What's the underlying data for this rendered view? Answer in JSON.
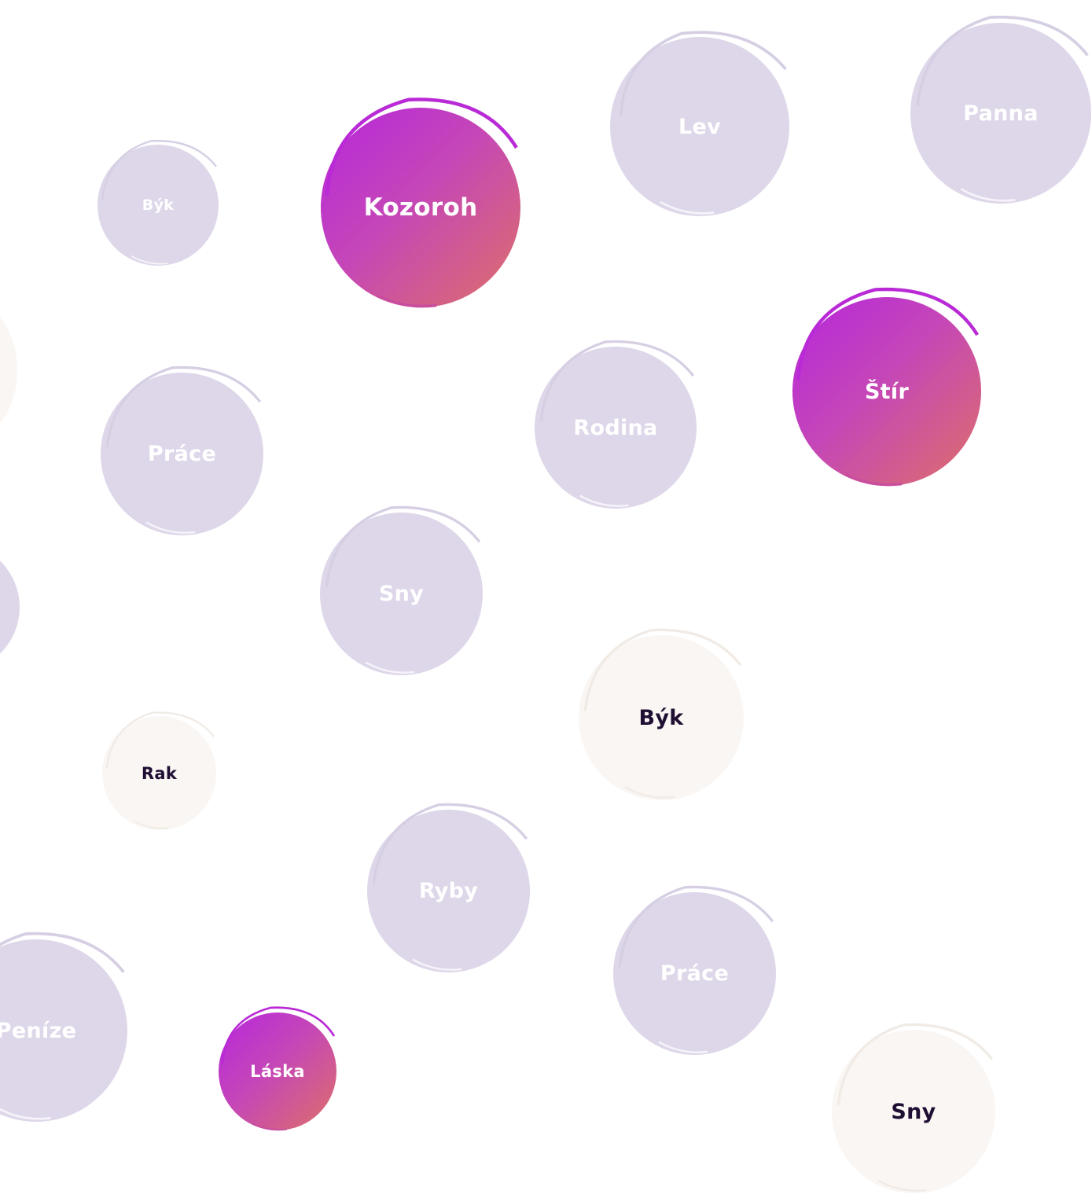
{
  "colors": {
    "lavender": "#ded7e9",
    "cream": "#faf6f3",
    "gradient_start": "#b627dc",
    "gradient_end": "#dd7068",
    "dark_text": "#1f0f33",
    "light_text": "#ffffff"
  },
  "bubbles": {
    "lev": {
      "label": "Lev",
      "style": "lavender"
    },
    "panna": {
      "label": "Panna",
      "style": "lavender"
    },
    "byk_small": {
      "label": "Býk",
      "style": "lavender"
    },
    "kozoroh": {
      "label": "Kozoroh",
      "style": "gradient"
    },
    "stir": {
      "label": "Štír",
      "style": "gradient"
    },
    "prace_1": {
      "label": "Práce",
      "style": "lavender"
    },
    "rodina": {
      "label": "Rodina",
      "style": "lavender"
    },
    "sny_1": {
      "label": "Sny",
      "style": "lavender"
    },
    "byk_large": {
      "label": "Býk",
      "style": "cream"
    },
    "rak": {
      "label": "Rak",
      "style": "cream"
    },
    "ryby": {
      "label": "Ryby",
      "style": "lavender"
    },
    "prace_2": {
      "label": "Práce",
      "style": "lavender"
    },
    "penize": {
      "label": "Peníze",
      "style": "lavender"
    },
    "laska": {
      "label": "Láska",
      "style": "gradient"
    },
    "sny_2": {
      "label": "Sny",
      "style": "cream"
    },
    "edge_1": {
      "label": "",
      "style": "cream"
    },
    "edge_2": {
      "label": "",
      "style": "lavender"
    }
  }
}
